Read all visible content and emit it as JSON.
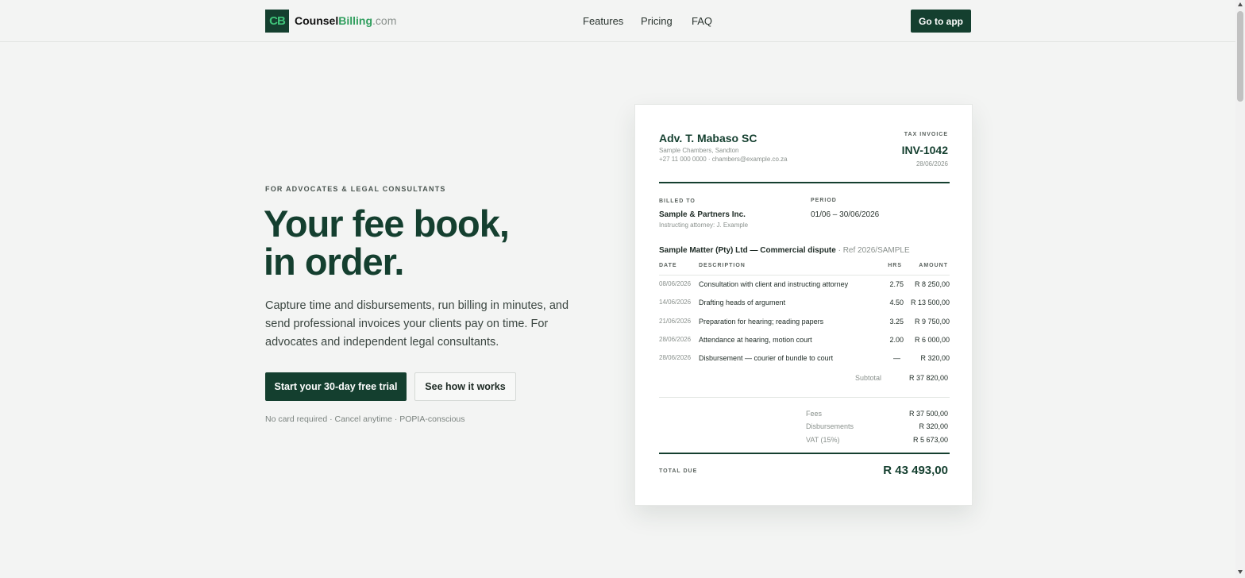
{
  "header": {
    "logo_mark": "CB",
    "logo_counsel": "Counsel",
    "logo_billing": "Billing",
    "logo_domain": ".com",
    "nav": [
      "Features",
      "Pricing",
      "FAQ"
    ],
    "app_button": "Go to app"
  },
  "hero": {
    "eyebrow": "FOR ADVOCATES & LEGAL CONSULTANTS",
    "title_line1": "Your fee book,",
    "title_line2": "in order.",
    "description": "Capture time and disbursements, run billing in minutes, and send professional invoices your clients pay on time. For advocates and independent legal consultants.",
    "primary_cta": "Start your 30-day free trial",
    "secondary_cta": "See how it works",
    "fineprint": "No card required · Cancel anytime · POPIA-conscious"
  },
  "invoice": {
    "advocate_name": "Adv. T. Mabaso SC",
    "chambers": "Sample Chambers, Sandton",
    "contact": "+27 11 000 0000 · chambers@example.co.za",
    "doc_type": "TAX INVOICE",
    "number": "INV-1042",
    "date": "28/06/2026",
    "billed_to_label": "BILLED TO",
    "billed_to_name": "Sample & Partners Inc.",
    "billed_to_attorney": "Instructing attorney: J. Example",
    "period_label": "PERIOD",
    "period_value": "01/06 – 30/06/2026",
    "matter_title": "Sample Matter (Pty) Ltd — Commercial dispute",
    "matter_ref": " · Ref 2026/SAMPLE",
    "columns": {
      "date": "DATE",
      "description": "DESCRIPTION",
      "hrs": "HRS",
      "amount": "AMOUNT"
    },
    "lines": [
      {
        "date": "08/06/2026",
        "description": "Consultation with client and instructing attorney",
        "hrs": "2.75",
        "amount": "R 8 250,00"
      },
      {
        "date": "14/06/2026",
        "description": "Drafting heads of argument",
        "hrs": "4.50",
        "amount": "R 13 500,00"
      },
      {
        "date": "21/06/2026",
        "description": "Preparation for hearing; reading papers",
        "hrs": "3.25",
        "amount": "R 9 750,00"
      },
      {
        "date": "28/06/2026",
        "description": "Attendance at hearing, motion court",
        "hrs": "2.00",
        "amount": "R 6 000,00"
      },
      {
        "date": "28/06/2026",
        "description": "Disbursement — courier of bundle to court",
        "hrs": "—",
        "amount": "R 320,00"
      }
    ],
    "subtotal_label": "Subtotal",
    "subtotal_value": "R 37 820,00",
    "summary": [
      {
        "label": "Fees",
        "value": "R 37 500,00"
      },
      {
        "label": "Disbursements",
        "value": "R 320,00"
      },
      {
        "label": "VAT (15%)",
        "value": "R 5 673,00"
      }
    ],
    "total_label": "TOTAL DUE",
    "total_value": "R 43 493,00"
  },
  "colors": {
    "brand_dark": "#143f2f",
    "brand_green": "#2f9e5d",
    "background": "#f3f4f3"
  }
}
